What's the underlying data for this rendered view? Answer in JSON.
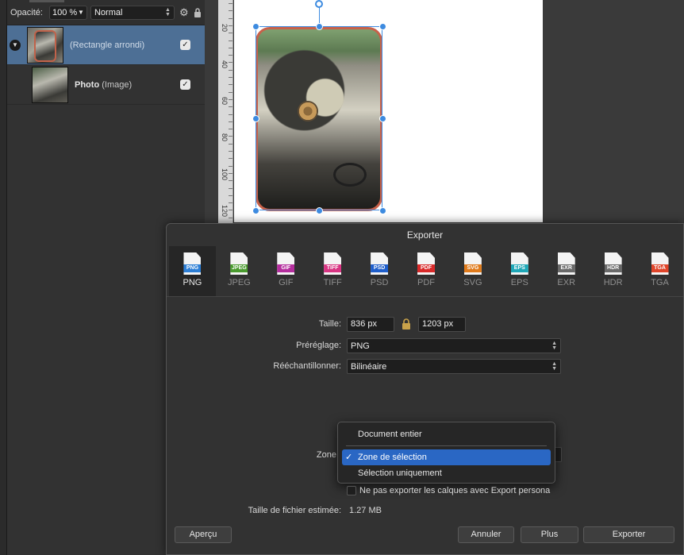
{
  "layers_panel": {
    "opacity_label": "Opacité:",
    "opacity_value": "100 %",
    "blend_mode": "Normal",
    "layers": [
      {
        "name": "(Rectangle arrondi)",
        "type": "",
        "selected": true,
        "checked": true
      },
      {
        "name": "Photo",
        "type": "(Image)",
        "selected": false,
        "checked": true
      }
    ]
  },
  "ruler": {
    "labels": [
      "20",
      "40",
      "60",
      "80",
      "100",
      "120"
    ]
  },
  "dialog": {
    "title": "Exporter",
    "formats": [
      {
        "label": "PNG",
        "tag": "PNG",
        "color": "#2d7fd6",
        "active": true
      },
      {
        "label": "JPEG",
        "tag": "JPEG",
        "color": "#4a9b2f",
        "active": false
      },
      {
        "label": "GIF",
        "tag": "GIF",
        "color": "#b52e9e",
        "active": false
      },
      {
        "label": "TIFF",
        "tag": "TIFF",
        "color": "#d83583",
        "active": false
      },
      {
        "label": "PSD",
        "tag": "PSD",
        "color": "#1f5fcc",
        "active": false
      },
      {
        "label": "PDF",
        "tag": "PDF",
        "color": "#d92a2a",
        "active": false
      },
      {
        "label": "SVG",
        "tag": "SVG",
        "color": "#e07b1c",
        "active": false
      },
      {
        "label": "EPS",
        "tag": "EPS",
        "color": "#1fa8b8",
        "active": false
      },
      {
        "label": "EXR",
        "tag": "EXR",
        "color": "#6a6a6a",
        "active": false
      },
      {
        "label": "HDR",
        "tag": "HDR",
        "color": "#6a6a6a",
        "active": false
      },
      {
        "label": "TGA",
        "tag": "TGA",
        "color": "#e0452a",
        "active": false
      }
    ],
    "size_label": "Taille:",
    "width_value": "836 px",
    "height_value": "1203 px",
    "preset_label": "Préréglage:",
    "preset_value": "PNG",
    "resample_label": "Rééchantillonner:",
    "resample_value": "Bilinéaire",
    "zone_label": "Zone",
    "zone_menu": {
      "items": [
        "Document entier",
        "Zone de sélection",
        "Sélection uniquement"
      ],
      "selected": "Zone de sélection",
      "checkmark": "✓"
    },
    "no_export_layers_label": "Ne pas exporter les calques avec Export persona",
    "filesize_label": "Taille de fichier estimée:",
    "filesize_value": "1.27 MB",
    "buttons": {
      "preview": "Aperçu",
      "cancel": "Annuler",
      "more": "Plus",
      "export": "Exporter"
    }
  }
}
